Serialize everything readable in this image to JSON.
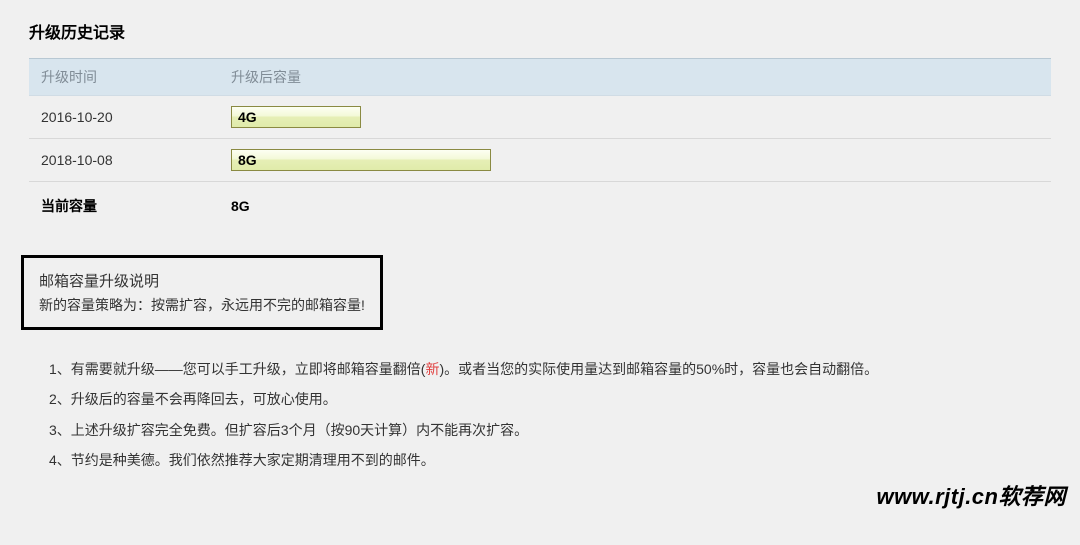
{
  "title": "升级历史记录",
  "table": {
    "headers": {
      "col1": "升级时间",
      "col2": "升级后容量"
    },
    "rows": [
      {
        "date": "2016-10-20",
        "capacity": "4G",
        "barClass": "bar-4g"
      },
      {
        "date": "2018-10-08",
        "capacity": "8G",
        "barClass": "bar-8g"
      }
    ],
    "currentRow": {
      "label": "当前容量",
      "value": "8G"
    }
  },
  "noticeBox": {
    "title": "邮箱容量升级说明",
    "text": "新的容量策略为：按需扩容，永远用不完的邮箱容量!"
  },
  "rules": [
    {
      "num": "1、",
      "pre": "有需要就升级——您可以手工升级，立即将邮箱容量翻倍(",
      "new": "新",
      "post": ")。或者当您的实际使用量达到邮箱容量的50%时，容量也会自动翻倍。"
    },
    {
      "num": "2、",
      "pre": "升级后的容量不会再降回去，可放心使用。",
      "new": "",
      "post": ""
    },
    {
      "num": "3、",
      "pre": "上述升级扩容完全免费。但扩容后3个月（按90天计算）内不能再次扩容。",
      "new": "",
      "post": ""
    },
    {
      "num": "4、",
      "pre": "节约是种美德。我们依然推荐大家定期清理用不到的邮件。",
      "new": "",
      "post": ""
    }
  ],
  "watermark": "www.rjtj.cn软荐网"
}
